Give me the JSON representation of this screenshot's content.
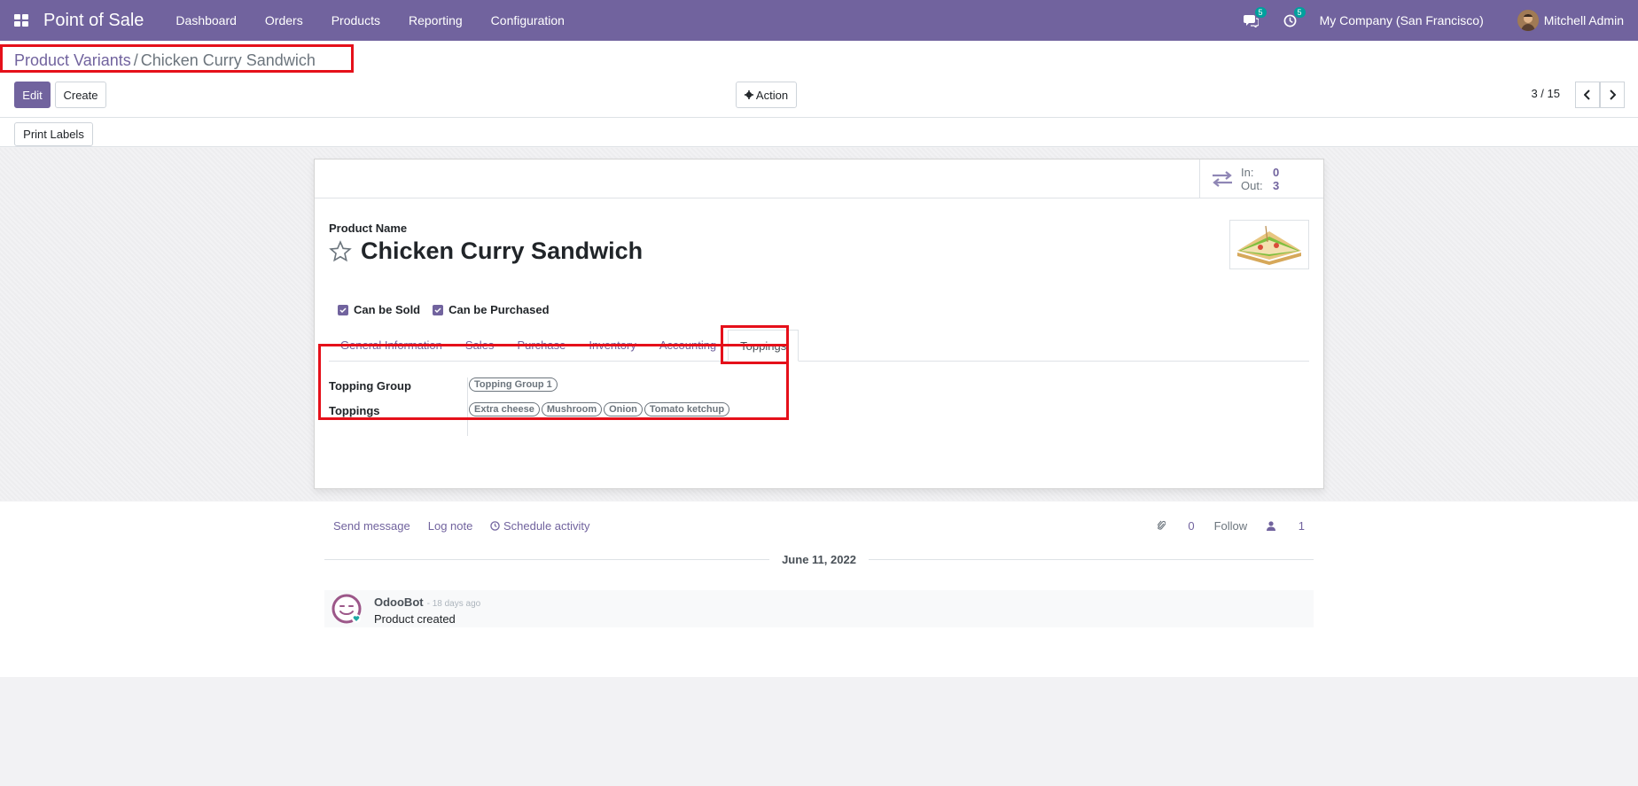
{
  "navbar": {
    "app_name": "Point of Sale",
    "menu": [
      "Dashboard",
      "Orders",
      "Products",
      "Reporting",
      "Configuration"
    ],
    "messages_count": "5",
    "activities_count": "5",
    "company": "My Company (San Francisco)",
    "user": "Mitchell Admin"
  },
  "breadcrumb": {
    "parent": "Product Variants",
    "separator": "/",
    "current": "Chicken Curry Sandwich"
  },
  "buttons": {
    "edit": "Edit",
    "create": "Create",
    "action": "Action",
    "print_labels": "Print Labels"
  },
  "pager": {
    "value": "3 / 15"
  },
  "stat": {
    "in_label": "In:",
    "in_value": "0",
    "out_label": "Out:",
    "out_value": "3"
  },
  "product": {
    "name_label": "Product Name",
    "name": "Chicken Curry Sandwich",
    "can_be_sold": "Can be Sold",
    "can_be_purchased": "Can be Purchased"
  },
  "tabs": [
    "General Information",
    "Sales",
    "Purchase",
    "Inventory",
    "Accounting",
    "Toppings"
  ],
  "toppings": {
    "group_label": "Topping Group",
    "group_value": "Topping Group 1",
    "toppings_label": "Toppings",
    "items": [
      "Extra cheese",
      "Mushroom",
      "Onion",
      "Tomato ketchup"
    ]
  },
  "chatter": {
    "send_message": "Send message",
    "log_note": "Log note",
    "schedule_activity": "Schedule activity",
    "attachments": "0",
    "follow": "Follow",
    "followers": "1",
    "date": "June 11, 2022",
    "author": "OdooBot",
    "time_ago": "- 18 days ago",
    "body": "Product created"
  },
  "colors": {
    "brand": "#71639e",
    "highlight": "#e5101a",
    "badge": "#00a09d"
  }
}
